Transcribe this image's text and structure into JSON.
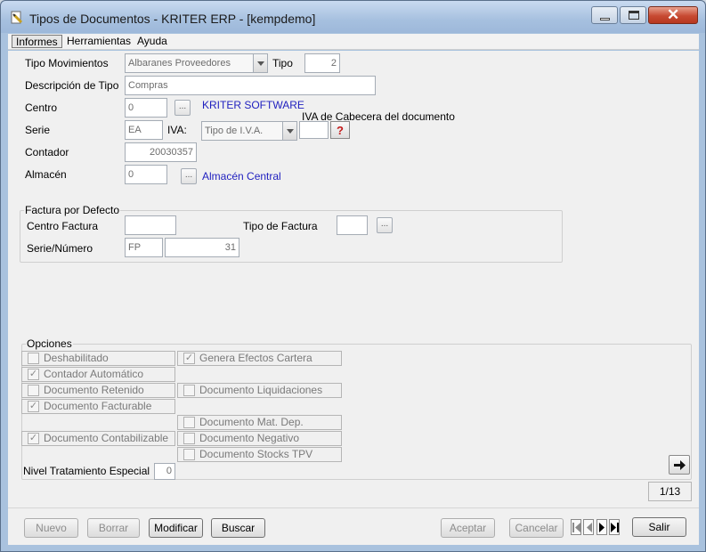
{
  "window": {
    "title": "Tipos de Documentos - KRITER ERP - [kempdemo]",
    "controls": {
      "minimize": "minimize-icon",
      "maximize": "maximize-icon",
      "close": "close-icon"
    }
  },
  "menu": {
    "items": [
      "Informes",
      "Herramientas",
      "Ayuda"
    ]
  },
  "form": {
    "tipo_movimientos": {
      "label": "Tipo Movimientos",
      "value": "Albaranes Proveedores"
    },
    "tipo": {
      "label": "Tipo",
      "value": "2"
    },
    "descripcion": {
      "label": "Descripción de Tipo",
      "value": "Compras"
    },
    "centro": {
      "label": "Centro",
      "value": "0",
      "link": "KRITER SOFTWARE"
    },
    "serie": {
      "label": "Serie",
      "value": "EA"
    },
    "iva": {
      "label": "IVA:",
      "value": "Tipo de I.V.A.",
      "header_label": "IVA de Cabecera del documento"
    },
    "contador": {
      "label": "Contador",
      "value": "20030357"
    },
    "almacen": {
      "label": "Almacén",
      "value": "0",
      "link": "Almacén Central"
    }
  },
  "factura": {
    "title": "Factura por Defecto",
    "centro_label": "Centro Factura",
    "tipo_label": "Tipo de Factura",
    "serie_label": "Serie/Número",
    "serie_value": "FP",
    "numero_value": "31"
  },
  "opciones": {
    "title": "Opciones",
    "items": [
      {
        "label": "Deshabilitado",
        "checked": false
      },
      {
        "label": "Genera Efectos Cartera",
        "checked": true
      },
      {
        "label": "Contador Automático",
        "checked": true
      },
      {
        "label": "Documento Retenido",
        "checked": false
      },
      {
        "label": "Documento Liquidaciones",
        "checked": false
      },
      {
        "label": "Documento Facturable",
        "checked": true
      },
      {
        "label": "Documento Mat. Dep.",
        "checked": false
      },
      {
        "label": "Documento Contabilizable",
        "checked": true
      },
      {
        "label": "Documento Negativo",
        "checked": false
      },
      {
        "label": "Documento Stocks TPV",
        "checked": false
      }
    ],
    "nivel": {
      "label": "Nivel Tratamiento Especial",
      "value": "0"
    }
  },
  "pagination": "1/13",
  "buttons": {
    "nuevo": "Nuevo",
    "borrar": "Borrar",
    "modificar": "Modificar",
    "buscar": "Buscar",
    "aceptar": "Aceptar",
    "cancelar": "Cancelar",
    "salir": "Salir"
  },
  "icons": {
    "app": "document-icon",
    "help": "question-icon",
    "next": "arrow-right-icon",
    "nav": [
      "first-record-icon",
      "previous-record-icon",
      "next-record-icon",
      "last-record-icon"
    ]
  },
  "colors": {
    "link": "#1f1fbf",
    "titlebar": "#a6c0df",
    "close": "#c74a32"
  }
}
